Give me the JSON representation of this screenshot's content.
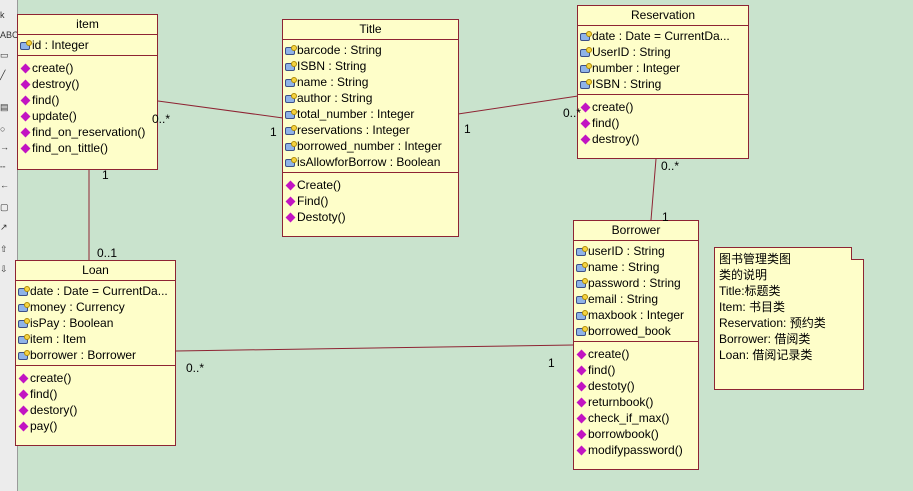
{
  "classes": {
    "item": {
      "name": "item",
      "attributes": [
        "id : Integer"
      ],
      "operations": [
        "create()",
        "destroy()",
        "find()",
        "update()",
        "find_on_reservation()",
        "find_on_tittle()"
      ]
    },
    "title": {
      "name": "Title",
      "attributes": [
        "barcode : String",
        "ISBN : String",
        "name : String",
        "author : String",
        "total_number : Integer",
        "reservations : Integer",
        "borrowed_number : Integer",
        "isAllowforBorrow : Boolean"
      ],
      "operations": [
        "Create()",
        "Find()",
        "Destoty()"
      ]
    },
    "reservation": {
      "name": "Reservation",
      "attributes": [
        "date : Date = CurrentDa...",
        "UserID : String",
        "number : Integer",
        "ISBN : String"
      ],
      "operations": [
        "create()",
        "find()",
        "destroy()"
      ]
    },
    "borrower": {
      "name": "Borrower",
      "attributes": [
        "userID : String",
        "name : String",
        "password : String",
        "email : String",
        "maxbook : Integer",
        "borrowed_book"
      ],
      "operations": [
        "create()",
        "find()",
        "destoty()",
        "returnbook()",
        "check_if_max()",
        "borrowbook()",
        "modifypassword()"
      ]
    },
    "loan": {
      "name": "Loan",
      "attributes": [
        "date : Date = CurrentDa...",
        "money : Currency",
        "isPay : Boolean",
        "item : Item",
        "borrower : Borrower"
      ],
      "operations": [
        "create()",
        "find()",
        "destory()",
        "pay()"
      ]
    }
  },
  "multiplicities": {
    "item_title_item": "0..*",
    "item_title_title": "1",
    "title_res_title": "1",
    "title_res_res": "0..*",
    "res_borrower_res": "0..*",
    "res_borrower_borrower": "1",
    "item_loan_item": "1",
    "item_loan_loan": "0..1",
    "loan_borrower_loan": "0..*",
    "loan_borrower_borrower": "1"
  },
  "note": {
    "lines": [
      "图书管理类图",
      "类的说明",
      "Title:标题类",
      "Item: 书目类",
      "Reservation: 预约类",
      "Borrower: 借阅类",
      "Loan: 借阅记录类"
    ]
  },
  "toolbar": {
    "tools": [
      "k",
      "ABC",
      "▭",
      "╱",
      "▤",
      "○",
      "→",
      "╌",
      "←",
      "▢",
      "↗",
      "⇧",
      "⇩"
    ]
  },
  "colors": {
    "canvas": "#c9e3cd",
    "class_fill": "#fefec9",
    "class_border": "#8e2433",
    "operation_icon": "#c214c2"
  }
}
